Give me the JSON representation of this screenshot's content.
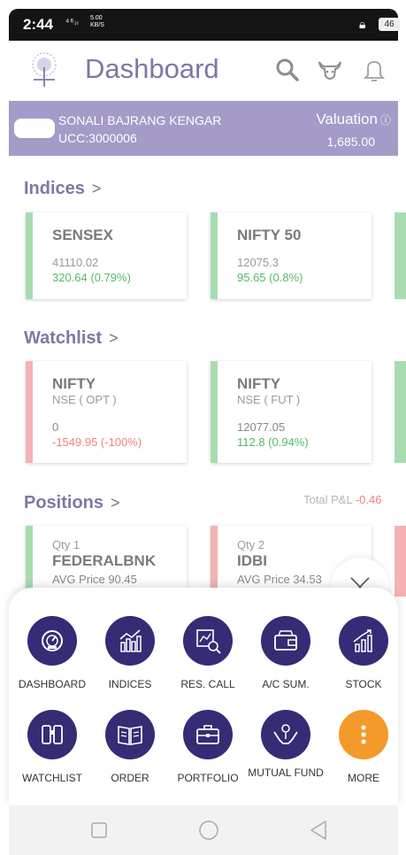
{
  "status_bar": {
    "time": "2:44",
    "network": "⁴⁶ᵢₗ",
    "speed_value": "5.00",
    "speed_unit": "KB/S",
    "battery": "46"
  },
  "header": {
    "title": "Dashboard"
  },
  "account": {
    "name": "SONALI BAJRANG KENGAR",
    "ucc": "UCC:3000006",
    "valuation_label": "Valuation",
    "valuation": "1,685.00"
  },
  "indices": {
    "title": "Indices",
    "cards": [
      {
        "name": "SENSEX",
        "value": "41110.02",
        "change": "320.64 (0.79%)"
      },
      {
        "name": "NIFTY 50",
        "value": "12075.3",
        "change": "95.65 (0.8%)"
      }
    ]
  },
  "watchlist": {
    "title": "Watchlist",
    "cards": [
      {
        "name": "NIFTY",
        "exchange": "NSE ( OPT )",
        "value": "0",
        "change": "-1549.95 (-100%)"
      },
      {
        "name": "NIFTY",
        "exchange": "NSE ( FUT )",
        "value": "12077.05",
        "change": "112.8 (0.94%)"
      }
    ]
  },
  "positions": {
    "title": "Positions",
    "pnl_label": "Total P&L",
    "pnl_value": "-0.46",
    "cards": [
      {
        "qty": "Qty 1",
        "name": "FEDERALBNK",
        "avg": "AVG Price 90.45"
      },
      {
        "qty": "Qty 2",
        "name": "IDBI",
        "avg": "AVG Price 34.53"
      }
    ]
  },
  "menu": {
    "items": [
      {
        "label": "DASHBOARD",
        "icon": "speedometer-icon"
      },
      {
        "label": "INDICES",
        "icon": "bar-chart-icon"
      },
      {
        "label": "RES. CALL",
        "icon": "magnifier-chart-icon"
      },
      {
        "label": "A/C SUM.",
        "icon": "wallet-icon"
      },
      {
        "label": "STOCK",
        "icon": "stock-chart-icon"
      },
      {
        "label": "WATCHLIST",
        "icon": "binoculars-icon"
      },
      {
        "label": "ORDER",
        "icon": "book-icon"
      },
      {
        "label": "PORTFOLIO",
        "icon": "briefcase-icon"
      },
      {
        "label": "MUTUAL FUND",
        "icon": "hands-money-icon"
      },
      {
        "label": "MORE",
        "icon": "more-vertical-icon"
      }
    ]
  },
  "colors": {
    "accent": "#352c76",
    "account_bar": "#a49bc8",
    "title": "#7d78a4",
    "positive": "#55b96a",
    "negative": "#ef8080",
    "more_button": "#f49a2a"
  }
}
